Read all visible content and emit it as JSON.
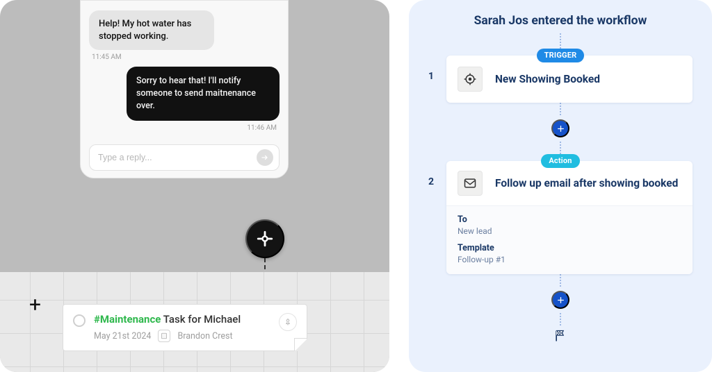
{
  "chat": {
    "incoming": {
      "text": "Help! My hot water has stopped working.",
      "time": "11:45 AM"
    },
    "outgoing": {
      "text": "Sorry to hear that! I'll notify someone to send maitnenance over.",
      "time": "11:46 AM"
    },
    "reply_placeholder": "Type a reply..."
  },
  "task": {
    "tag": "#Maintenance",
    "title_rest": " Task for Michael",
    "date": "May 21st 2024",
    "location": "Brandon Crest"
  },
  "workflow": {
    "title": "Sarah Jos entered the workflow",
    "trigger_label": "TRIGGER",
    "action_label": "Action",
    "step1": {
      "num": "1",
      "title": "New Showing Booked"
    },
    "step2": {
      "num": "2",
      "title": "Follow up email after showing booked",
      "to_label": "To",
      "to_value": "New lead",
      "template_label": "Template",
      "template_value": "Follow-up #1"
    }
  }
}
